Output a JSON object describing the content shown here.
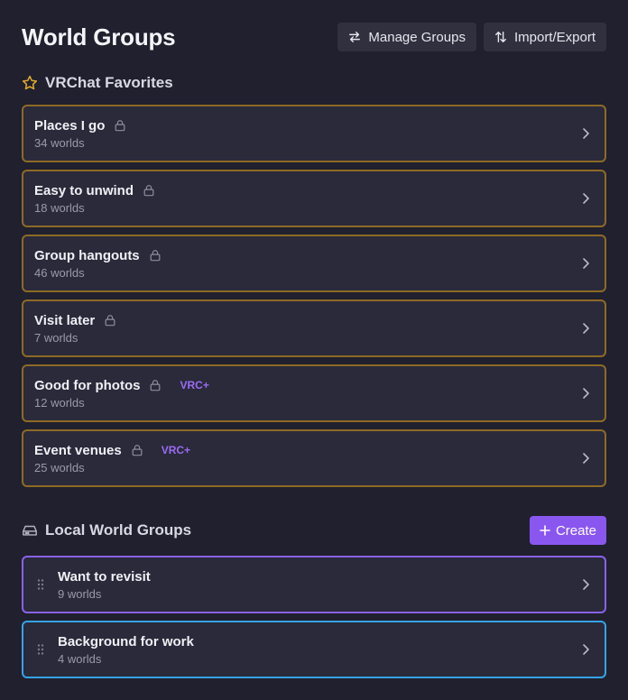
{
  "header": {
    "title": "World Groups",
    "manage_label": "Manage Groups",
    "import_label": "Import/Export"
  },
  "favorites": {
    "title": "VRChat Favorites",
    "icon": "star-icon",
    "items": [
      {
        "name": "Places I go",
        "count": "34 worlds",
        "badge": ""
      },
      {
        "name": "Easy to unwind",
        "count": "18 worlds",
        "badge": ""
      },
      {
        "name": "Group hangouts",
        "count": "46 worlds",
        "badge": ""
      },
      {
        "name": "Visit later",
        "count": "7 worlds",
        "badge": ""
      },
      {
        "name": "Good for photos",
        "count": "12 worlds",
        "badge": "VRC+"
      },
      {
        "name": "Event venues",
        "count": "25 worlds",
        "badge": "VRC+"
      }
    ]
  },
  "local": {
    "title": "Local World Groups",
    "icon": "hard-drive-icon",
    "create_label": "Create",
    "items": [
      {
        "name": "Want to revisit",
        "count": "9 worlds"
      },
      {
        "name": "Background for work",
        "count": "4 worlds"
      }
    ]
  },
  "colors": {
    "background": "#20202e",
    "card": "#2a2a3b",
    "favorite_border": "#8e6a26",
    "vrc_plus": "#9b6cf3",
    "create_button": "#8a56f0",
    "local_border_1": "#8a62e8",
    "local_border_2": "#35a3e6",
    "star": "#e0a92c"
  }
}
